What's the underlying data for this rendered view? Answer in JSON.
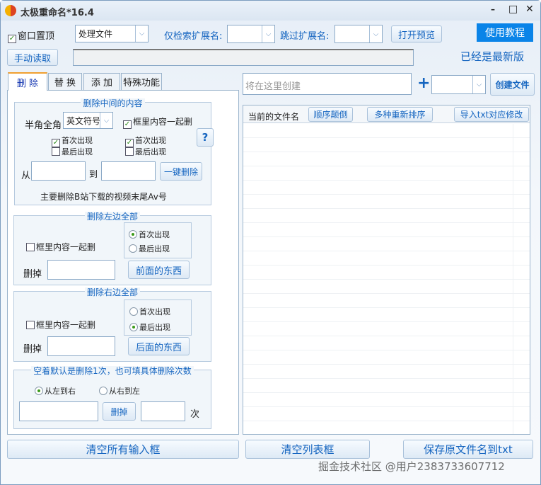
{
  "title": "太极重命名*16.4",
  "window_controls": {
    "minimize": "–",
    "maximize": "□",
    "close": "✕"
  },
  "toolbar": {
    "pin_top": "窗口置顶",
    "pin_top_checked": true,
    "mode_select": "处理文件",
    "only_ext_label": "仅检索扩展名:",
    "only_ext_value": "",
    "skip_ext_label": "跳过扩展名:",
    "skip_ext_value": "",
    "open_preview": "打开预览",
    "tutorial": "使用教程",
    "manual_read": "手动读取",
    "path_value": "",
    "version_status": "已经是最新版"
  },
  "tabs": [
    "删 除",
    "替 换",
    "添 加",
    "特殊功能"
  ],
  "delete_middle": {
    "title": "删除中间的内容",
    "width_label": "半角全角",
    "width_select": "英文符号",
    "include_bracket": "框里内容一起删",
    "first1": "首次出现",
    "last1": "最后出现",
    "first2": "首次出现",
    "last2": "最后出现",
    "help": "?",
    "from_label": "从",
    "to_label": "到",
    "one_click": "一键删除",
    "note": "主要删除B站下载的视频末尾Av号"
  },
  "delete_left": {
    "title": "删除左边全部",
    "include_bracket": "框里内容一起删",
    "first": "首次出现",
    "last": "最后出现",
    "del_label": "删掉",
    "button": "前面的东西"
  },
  "delete_right": {
    "title": "删除右边全部",
    "include_bracket": "框里内容一起删",
    "first": "首次出现",
    "last": "最后出现",
    "del_label": "删掉",
    "button": "后面的东西"
  },
  "delete_count": {
    "title": "空着默认是删除1次，也可填具体删除次数",
    "ltr": "从左到右",
    "rtl": "从右到左",
    "button": "删掉",
    "times_label": "次"
  },
  "create": {
    "placeholder": "将在这里创建",
    "plus": "+",
    "ext_value": "",
    "button": "创建文件"
  },
  "list": {
    "header": "当前的文件名",
    "reverse": "顺序颠倒",
    "resort": "多种重新排序",
    "import_txt": "导入txt对应修改"
  },
  "bottom": {
    "clear_inputs": "清空所有输入框",
    "clear_list": "清空列表框",
    "save_txt": "保存原文件名到txt"
  },
  "watermark": "掘金技术社区 @用户2383733607712"
}
